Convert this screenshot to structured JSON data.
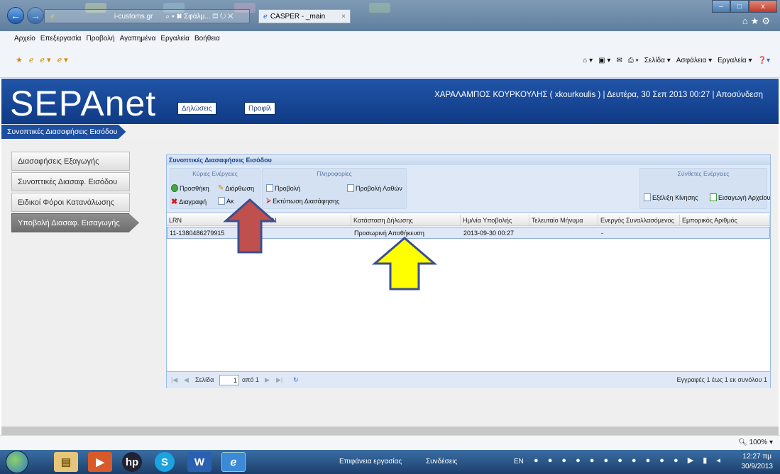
{
  "browser": {
    "address": "i-customs.gr",
    "address_controls": "⌕ ▾ ✖ Σφάλμ... ▤ ↻ ✕",
    "tab_title": "CASPER - _main",
    "tab_close": "×",
    "menu": [
      "Αρχείο",
      "Επεξεργασία",
      "Προβολή",
      "Αγαπημένα",
      "Εργαλεία",
      "Βοήθεια"
    ],
    "command_items": [
      "Σελίδα ▾",
      "Ασφάλεια ▾",
      "Εργαλεία ▾"
    ],
    "window_buttons": [
      "–",
      "□",
      "x"
    ],
    "zoom": "100%"
  },
  "site": {
    "logo": "SEPAnet",
    "nav_declarations": "Δηλώσεις",
    "nav_profile": "Προφίλ",
    "user_info": "ΧΑΡΑΛΑΜΠΟΣ ΚΟΥΡΚΟΥΛΗΣ ( xkourkoulis ) | Δευτέρα, 30 Σεπ 2013 00:27 | Αποσύνδεση",
    "breadcrumb": "Συνοπτικές Διασαφήσεις Εισόδου"
  },
  "sidebar": {
    "items": [
      {
        "label": "Διασαφήσεις Εξαγωγής"
      },
      {
        "label": "Συνοπτικές Διασαφ. Εισόδου"
      },
      {
        "label": "Ειδικοί Φόροι Κατανάλωσης"
      },
      {
        "label": "Υποβολή Διασαφ. Εισαγωγής"
      }
    ],
    "active_index": 3
  },
  "panel": {
    "title": "Συνοπτικές Διασαφήσεις Εισόδου",
    "group_main": "Κύριες Ενέργειες",
    "btn_add": "Προσθήκη",
    "btn_edit": "Διόρθωση",
    "btn_delete": "Διαγραφή",
    "btn_cancel": "Ακ",
    "group_info": "Πληροφορίες",
    "btn_view": "Προβολή",
    "btn_view_errors": "Προβολή Λαθών",
    "btn_print": "Εκτύπωση Διασάφησης",
    "group_complex": "Σύνθετες Ενέργειες",
    "btn_movement": "Εξέλιξη Κίνησης",
    "btn_import": "Εισαγωγή Αρχείου"
  },
  "grid": {
    "columns": [
      "LRN",
      "MRN",
      "Κατάσταση Δήλωσης",
      "Ημ/νία Υποβολής",
      "Τελευταίο Μήνυμα",
      "Ενεργός Συναλλασόμενος",
      "Εμπορικός Αριθμός"
    ],
    "rows": [
      {
        "lrn": "11-1380486279915",
        "mrn": "",
        "status": "Προσωρινή Αποθήκευση",
        "date": "2013-09-30 00:27",
        "last_message": "",
        "active_trader": "-",
        "commercial_no": ""
      }
    ]
  },
  "pager": {
    "page_label": "Σελίδα",
    "page_value": "1",
    "of_pages": "από 1",
    "records": "Εγγραφές 1 έως 1 εκ συνόλου 1"
  },
  "taskbar": {
    "desktop": "Επιφάνεια εργασίας",
    "links": "Συνδέσεις",
    "lang": "EN",
    "time": "12:27 πμ",
    "date": "30/9/2013"
  },
  "colors": {
    "site_header": "#1a4aa0",
    "annotation_red": "#c0504d",
    "annotation_yellow": "#ffff00",
    "annotation_outline": "#3b4f8f"
  }
}
